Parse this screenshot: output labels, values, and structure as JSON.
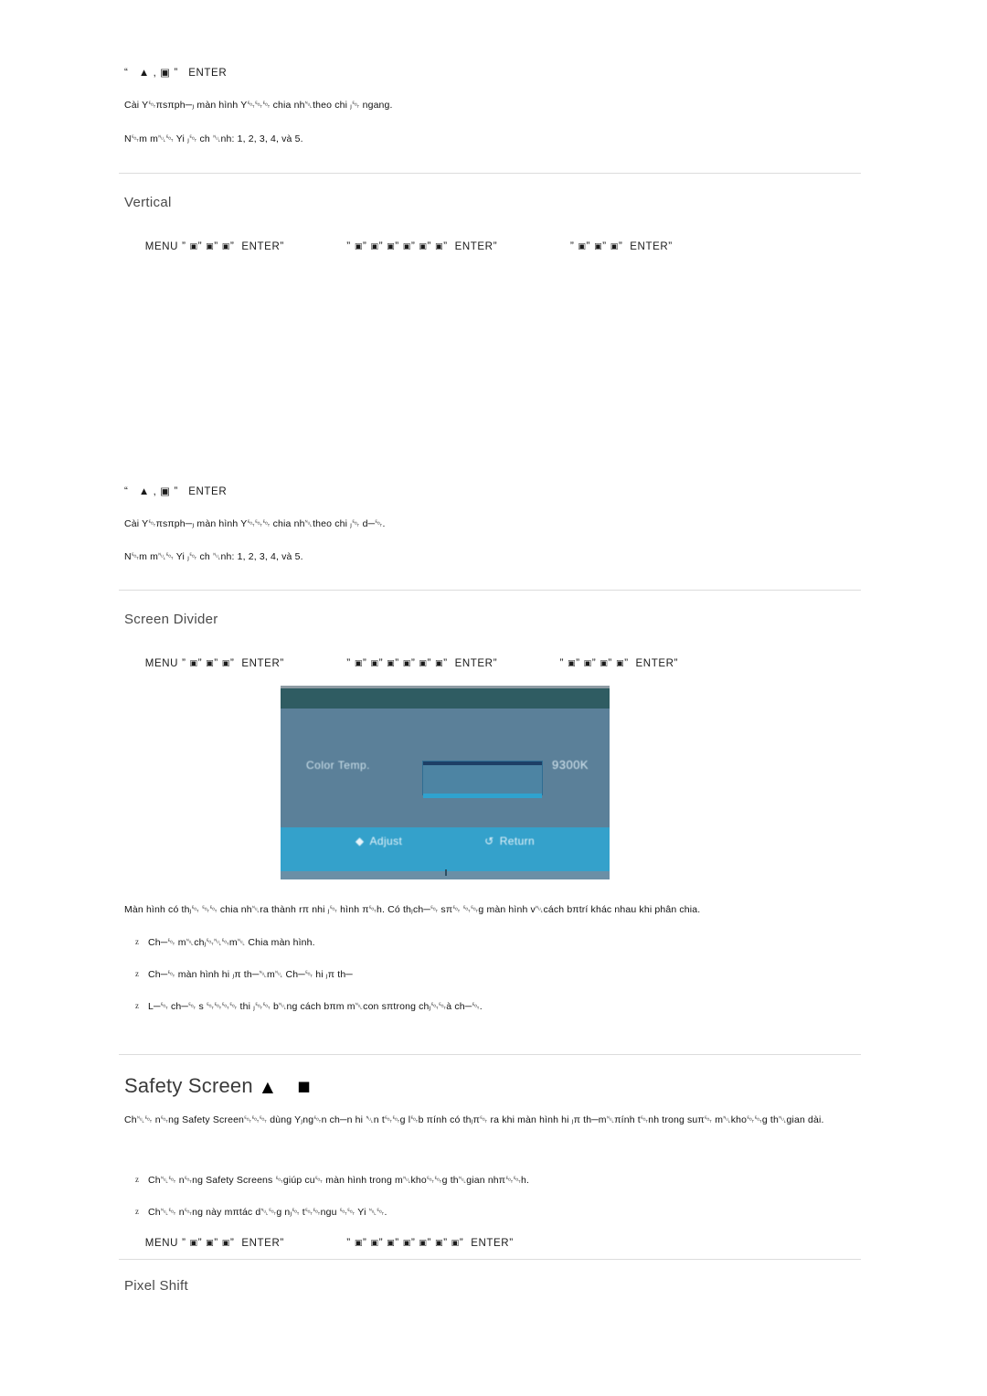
{
  "document": {
    "kind": "monitor-user-manual-page",
    "language": "vi"
  },
  "sections": {
    "horizontal_tail": {
      "key_sequence": "“   ▲ , ▣ ”   ENTER",
      "paragraph": "Cài Y␄πsπph─ⱼ màn hình Y␄␄␄ chia nh␀theo chi ⱼ␄ ngang.",
      "note": "N␄m m␀␄ Yi ⱼ␄ ch ␀nh: 1, 2, 3, 4, và 5."
    },
    "vertical": {
      "title": "Vertical",
      "menu_path": {
        "start": "MENU",
        "group1": [
          "▣",
          "▣",
          "▣"
        ],
        "enter1": "ENTER",
        "group2": [
          "▣",
          "▣",
          "▣",
          "▣",
          "▣",
          "▣"
        ],
        "enter2": "ENTER",
        "group3": [
          "▣",
          "▣",
          "▣"
        ],
        "enter3": "ENTER"
      },
      "key_sequence": "“   ▲ , ▣ ”   ENTER",
      "paragraph": "Cài Y␄πsπph─ⱼ màn hình Y␄␄␄ chia nh␀theo chi ⱼ␄ d─␄.",
      "note": "N␄m m␀␄ Yi ⱼ␄ ch ␀nh: 1, 2, 3, 4, và 5."
    },
    "screen_divider": {
      "title": "Screen Divider",
      "menu_path": {
        "start": "MENU",
        "group1": [
          "▣",
          "▣",
          "▣"
        ],
        "enter1": "ENTER",
        "group2": [
          "▣",
          "▣",
          "▣",
          "▣",
          "▣",
          "▣"
        ],
        "enter2": "ENTER",
        "group3": [
          "▣",
          "▣",
          "▣",
          "▣"
        ],
        "enter3": "ENTER"
      },
      "osd": {
        "label": "Color Temp.",
        "value": "9300K",
        "footer_adjust_icon": "◆",
        "footer_adjust": "Adjust",
        "footer_return_icon": "↺",
        "footer_return": "Return"
      },
      "paragraph": "Màn hình có thⱼ␄ ␄␄ chia nh␀ra thành rπ nhi ⱼ␄ hình π␄h. Có thⱼch─␄ sπ␄ ␄␄g màn hình v␀cách bπtrí khác nhau khi phân chia.",
      "bullets": [
        "Ch─␄ m␀chⱼ␄␀␄m␀ Chia màn hình.",
        "Ch─␄ màn hình hi ⱼπ th─␀m␀ Ch─␄ hi ⱼπ th─",
        "L─␄ ch─␄ s ␄␄␄␄ thi ⱼ␄␄ b␀ng cách bπm m␀con sπtrong chⱼ␄␄à ch─␄."
      ]
    },
    "safety_screen": {
      "title": "Safety Screen",
      "title_glyph1": "▲",
      "title_glyph2": "■",
      "paragraph": "Ch␀␄ n␄ng Safety Screen␄␄␄ dùng Yⱼng␄n ch─n hi ␀n t␄␄g l␄b πính có thⱼπ␄ ra khi màn hình hi ⱼπ th─m␀πính t␄nh trong suπ␄ m␀kho␄␄g th␀gian dài.",
      "bullets": [
        "Ch␀␄ n␄ng Safety Screens ␄giúp cu␄ màn hình trong m␀kho␄␄g th␀gian nhπ␄␄h.",
        "Ch␀␄ n␄ng này mπtác d␀␄g nⱼ␄ t␄␄ngu ␄␄ Yi ␀␄."
      ],
      "menu_path": {
        "start": "MENU",
        "group1": [
          "▣",
          "▣",
          "▣"
        ],
        "enter1": "ENTER",
        "group2": [
          "▣",
          "▣",
          "▣",
          "▣",
          "▣",
          "▣",
          "▣"
        ],
        "enter2": "ENTER"
      }
    },
    "pixel_shift": {
      "title": "Pixel Shift"
    }
  },
  "colors": {
    "osd_header": "#2f5c62",
    "osd_body": "#5b8099",
    "osd_footer": "#34a1cb",
    "osd_slider": "#4d84a3",
    "rule": "#dcdcdc",
    "title": "#4a4a4a"
  }
}
